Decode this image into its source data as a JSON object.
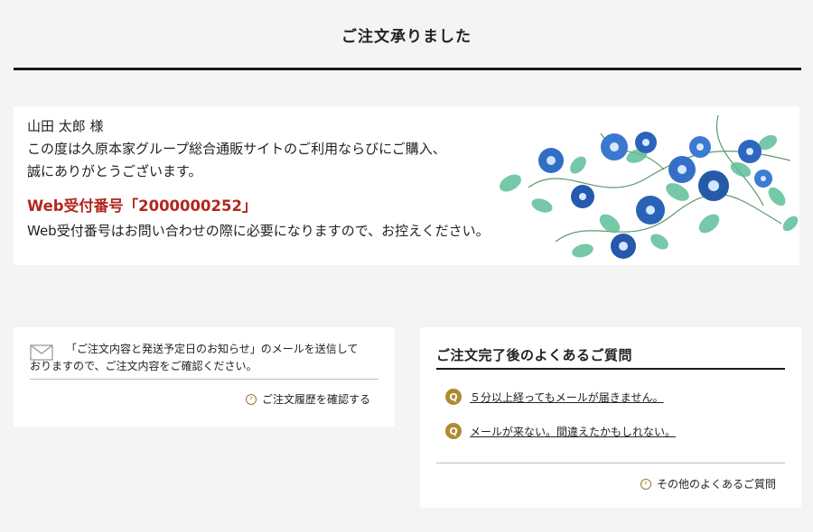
{
  "page": {
    "title": "ご注文承りました"
  },
  "greeting": {
    "name_line": "山田 太郎 様",
    "line1": "この度は久原本家グループ総合通販サイトのご利用ならびにご購入、",
    "line2": "誠にありがとうございます。",
    "web_id": "Web受付番号「2000000252」",
    "note": "Web受付番号はお問い合わせの際に必要になりますので、お控えください。",
    "accent_color": "#b3261e"
  },
  "mail_notice": {
    "line1": "「ご注文内容と発送予定日のお知らせ」のメールを送信して",
    "line2": "おりますので、ご注文内容をご確認ください。",
    "history_link": "ご注文履歴を確認する",
    "icon": "mail-icon"
  },
  "faq": {
    "title": "ご注文完了後のよくあるご質問",
    "badge": "Q",
    "badge_color": "#b08a2e",
    "items": [
      {
        "label": "５分以上経ってもメールが届きません。"
      },
      {
        "label": "メールが来ない。間違えたかもしれない。"
      }
    ],
    "more_link": "その他のよくあるご質問"
  }
}
